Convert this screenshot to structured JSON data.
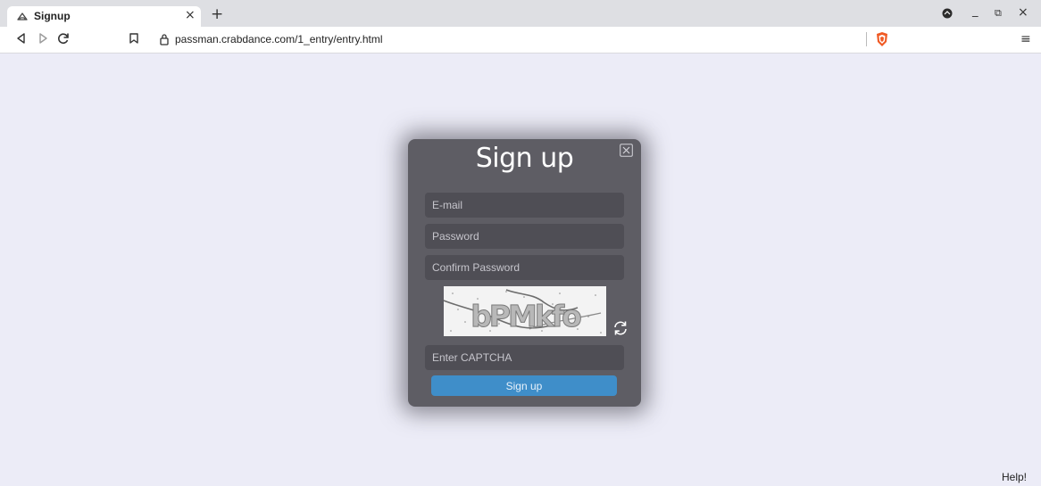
{
  "browser": {
    "tab_title": "Signup",
    "tab_close": "×",
    "new_tab": "+",
    "url": "passman.crabdance.com/1_entry/entry.html",
    "window_minimize": "_",
    "window_restore": "⧉",
    "window_close": "×",
    "menu": "≡",
    "icons": {
      "tab_favicon": "cloud-icon",
      "back": "back-arrow-icon",
      "forward": "forward-arrow-icon",
      "reload": "reload-icon",
      "bookmark": "bookmark-icon",
      "lock": "lock-icon",
      "shield": "brave-shield-icon",
      "profile": "profile-icon"
    }
  },
  "signup_modal": {
    "title": "Sign up",
    "email_placeholder": "E-mail",
    "password_placeholder": "Password",
    "confirm_password_placeholder": "Confirm Password",
    "captcha_text": "bPMkfo",
    "captcha_placeholder": "Enter CAPTCHA",
    "submit_label": "Sign up"
  },
  "footer": {
    "help": "Help!"
  },
  "colors": {
    "page_bg": "#ececf7",
    "modal_bg": "#5e5d64",
    "field_bg": "#4f4e55",
    "button_bg": "#3f8ec9"
  }
}
